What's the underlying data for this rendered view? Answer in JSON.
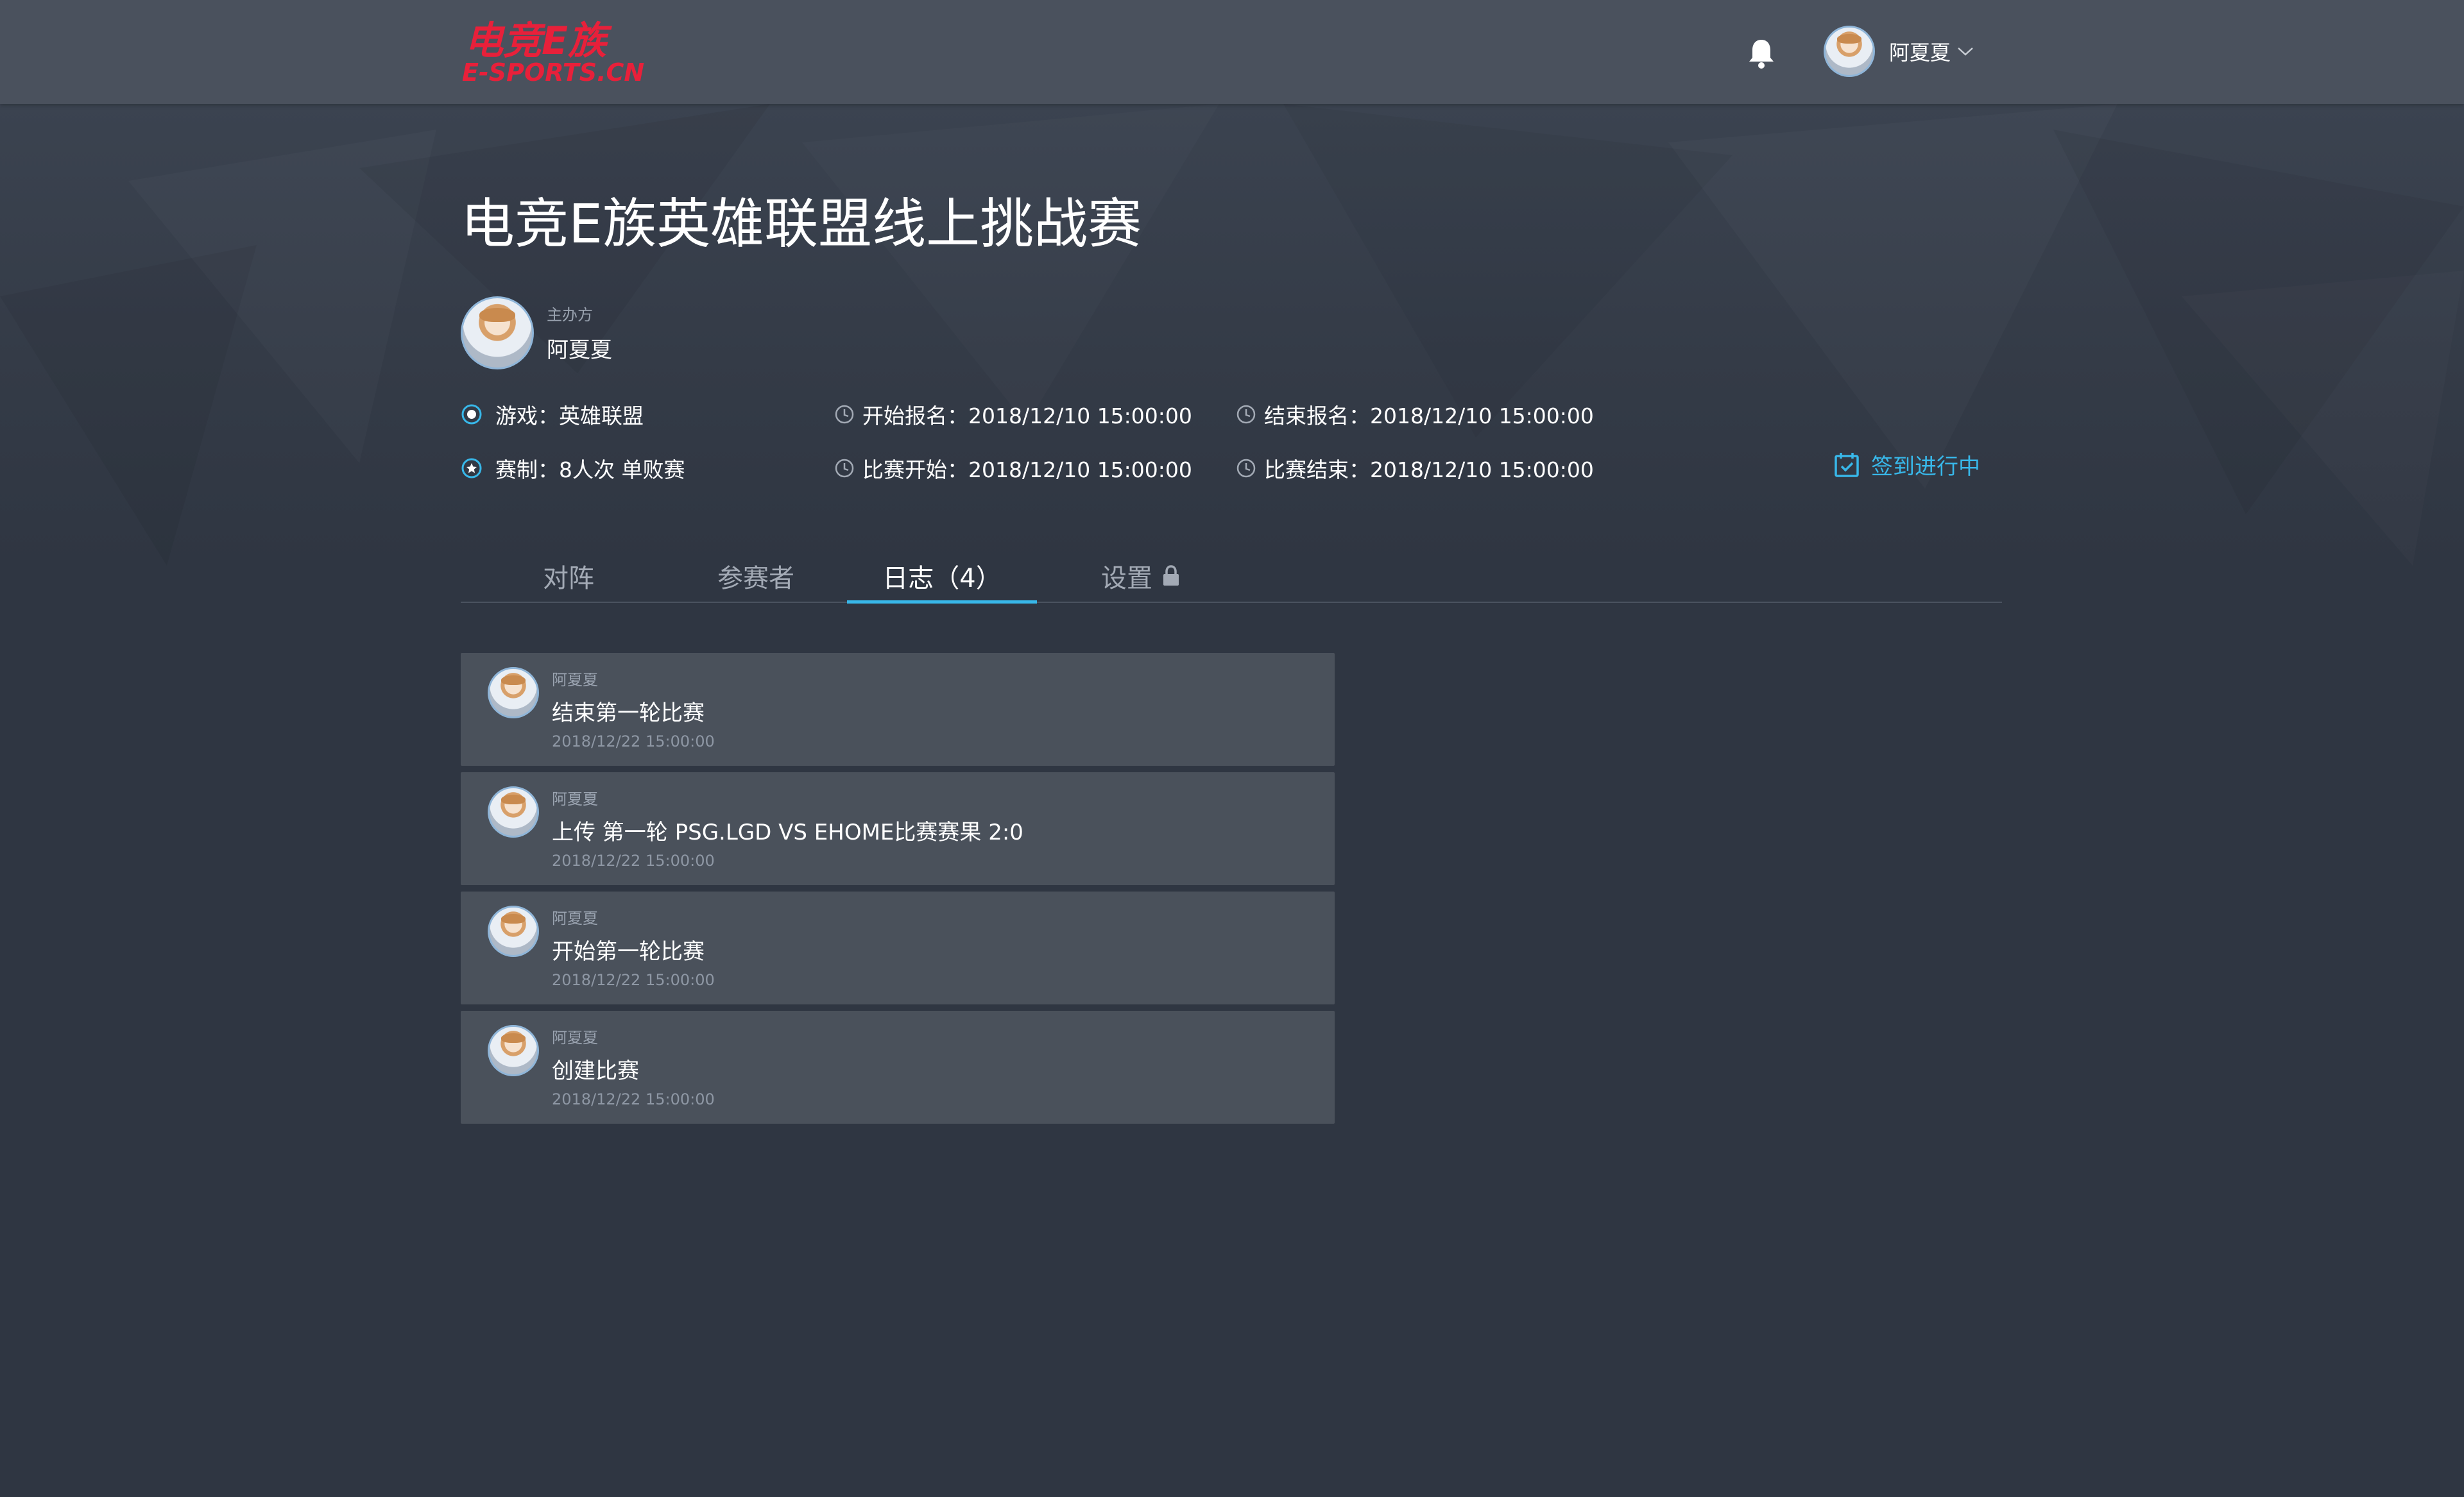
{
  "header": {
    "logo_text_top": "电竞E族",
    "logo_text_bottom": "E-SPORTS.CN",
    "username": "阿夏夏",
    "icons": {
      "notification": "bell-icon",
      "dropdown": "chevron-down-icon"
    }
  },
  "event": {
    "title": "电竞E族英雄联盟线上挑战赛",
    "organizer_label": "主办方",
    "organizer_name": "阿夏夏",
    "game": "游戏：英雄联盟",
    "format": "赛制：8人次  单败赛",
    "reg_start": "开始报名：2018/12/10  15:00:00",
    "reg_end": "结束报名：2018/12/10  15:00:00",
    "match_start": "比赛开始：2018/12/10  15:00:00",
    "match_end": "比赛结束：2018/12/10  15:00:00",
    "checkin_status": "签到进行中"
  },
  "tabs": [
    {
      "label": "对阵",
      "active": false
    },
    {
      "label": "参赛者",
      "active": false
    },
    {
      "label": "日志（4）",
      "active": true
    },
    {
      "label": "设置",
      "active": false,
      "icon": "lock-icon"
    }
  ],
  "logs": [
    {
      "user": "阿夏夏",
      "text": "结束第一轮比赛",
      "time": "2018/12/22  15:00:00"
    },
    {
      "user": "阿夏夏",
      "text": "上传  第一轮 PSG.LGD VS EHOME比赛赛果 2:0",
      "time": "2018/12/22  15:00:00"
    },
    {
      "user": "阿夏夏",
      "text": "开始第一轮比赛",
      "time": "2018/12/22  15:00:00"
    },
    {
      "user": "阿夏夏",
      "text": "创建比赛",
      "time": "2018/12/22  15:00:00"
    }
  ],
  "colors": {
    "background": "#2f3642",
    "header": "#4a515d",
    "accent": "#38b8ea",
    "brand_red": "#e8203a",
    "card": "#4a515b"
  }
}
